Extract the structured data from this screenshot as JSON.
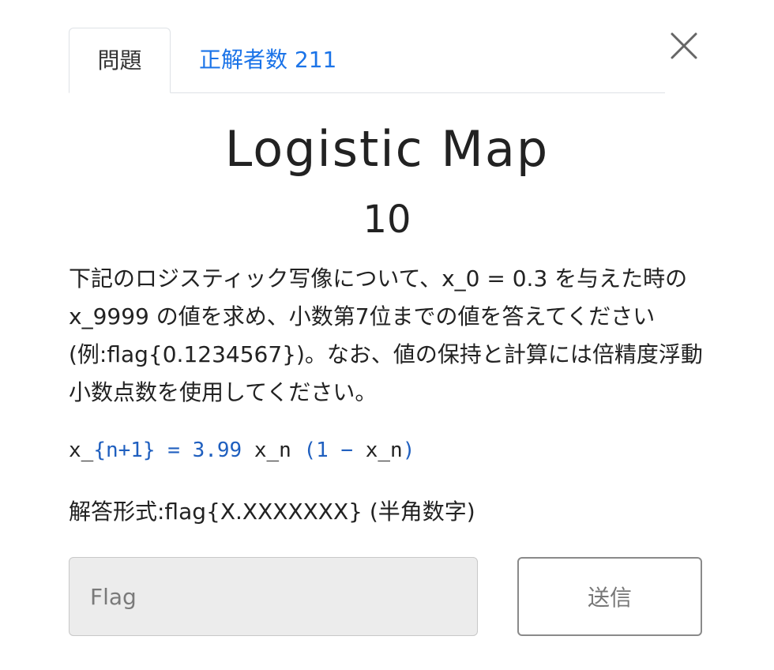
{
  "tabs": {
    "problem_label": "問題",
    "solvers_label": "正解者数 211"
  },
  "problem": {
    "title": "Logistic Map",
    "points": "10",
    "description": "下記のロジスティック写像について、x_0 = 0.3 を与えた時の x_9999 の値を求め、小数第7位までの値を答えてください(例:flag{0.1234567})。なお、値の保持と計算には倍精度浮動小数点数を使用してください。",
    "formula": {
      "part1": "x_",
      "part2": "{n+1}",
      "part3": " = ",
      "part4": "3.99",
      "part5": " x_n ",
      "part6": "(1",
      "part7": " − ",
      "part8": "x_n",
      "part9": ")"
    },
    "answer_format": "解答形式:flag{X.XXXXXXX} (半角数字)"
  },
  "form": {
    "flag_placeholder": "Flag",
    "flag_value": "",
    "submit_label": "送信"
  },
  "colors": {
    "link": "#1a73e8",
    "formula_accent": "#1f5fbf"
  },
  "icons": {
    "close": "close-icon"
  }
}
